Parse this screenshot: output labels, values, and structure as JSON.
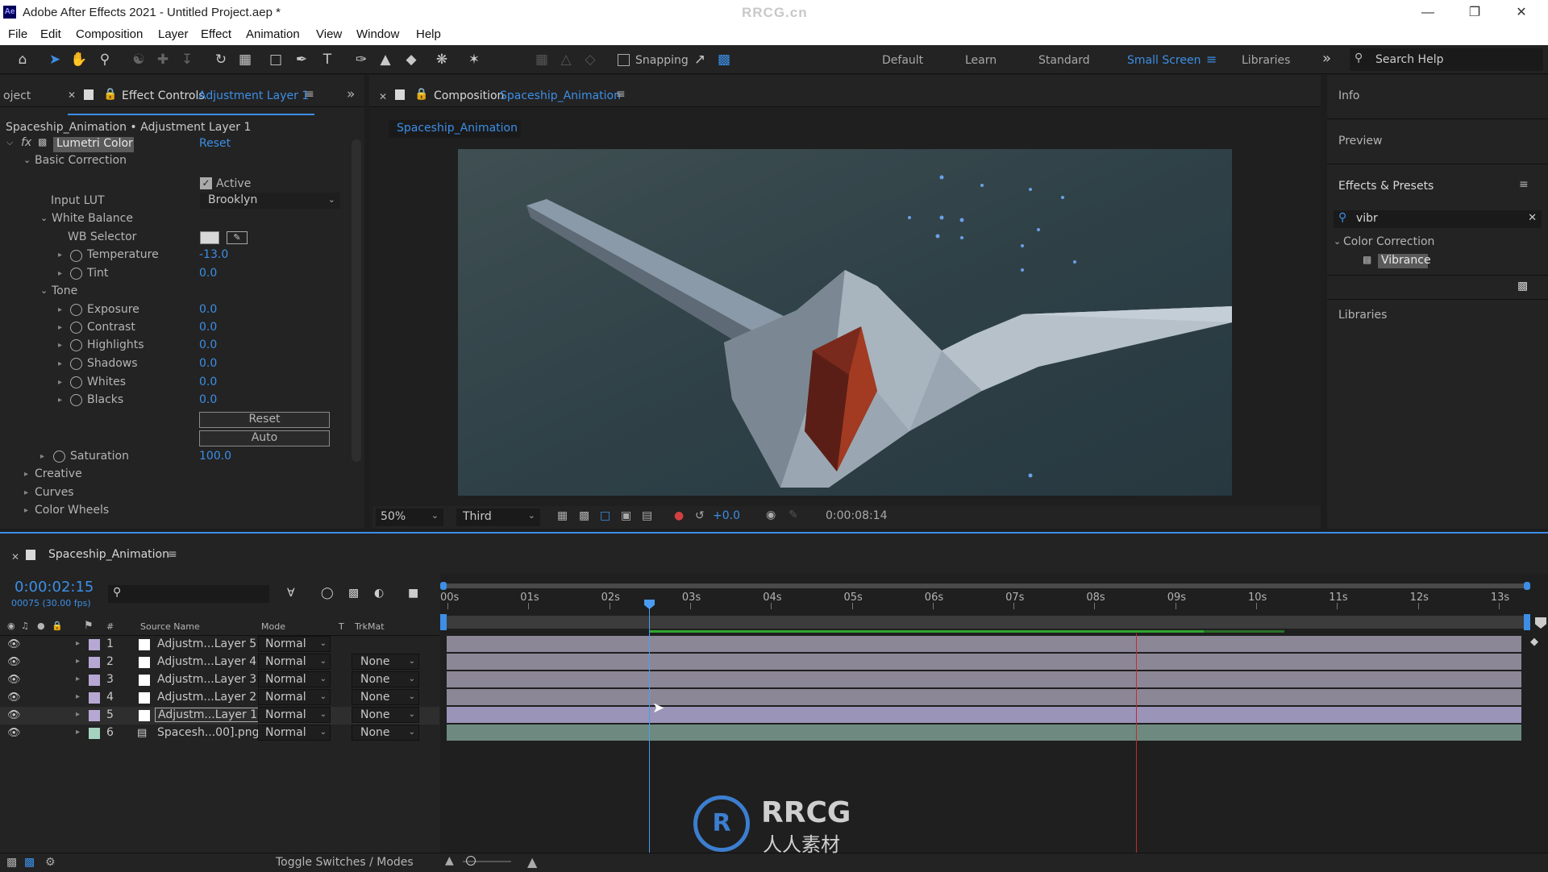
{
  "window": {
    "title": "Adobe After Effects 2021 - Untitled Project.aep *",
    "watermark": "RRCG.cn",
    "app_icon": "Ae"
  },
  "menu": [
    "File",
    "Edit",
    "Composition",
    "Layer",
    "Effect",
    "Animation",
    "View",
    "Window",
    "Help"
  ],
  "toolbar": {
    "snapping": "Snapping",
    "workspaces": [
      "Default",
      "Learn",
      "Standard",
      "Small Screen",
      "Libraries"
    ],
    "active_workspace": "Small Screen",
    "search_placeholder": "Search Help"
  },
  "effect_controls": {
    "project_tab": "oject",
    "tab_label": "Effect Controls",
    "tab_layer": "Adjustment Layer 1",
    "breadcrumb": "Spaceship_Animation • Adjustment Layer 1",
    "effect": "Lumetri Color",
    "reset": "Reset",
    "basic_correction": "Basic Correction",
    "active": "Active",
    "input_lut_label": "Input LUT",
    "input_lut": "Brooklyn",
    "white_balance": "White Balance",
    "wb_selector": "WB Selector",
    "temperature_label": "Temperature",
    "temperature": "-13.0",
    "tint_label": "Tint",
    "tint": "0.0",
    "tone": "Tone",
    "tone_props": [
      {
        "label": "Exposure",
        "value": "0.0"
      },
      {
        "label": "Contrast",
        "value": "0.0"
      },
      {
        "label": "Highlights",
        "value": "0.0"
      },
      {
        "label": "Shadows",
        "value": "0.0"
      },
      {
        "label": "Whites",
        "value": "0.0"
      },
      {
        "label": "Blacks",
        "value": "0.0"
      }
    ],
    "reset_btn": "Reset",
    "auto_btn": "Auto",
    "saturation_label": "Saturation",
    "saturation": "100.0",
    "sections": [
      "Creative",
      "Curves",
      "Color Wheels"
    ]
  },
  "composition": {
    "tab_label": "Composition",
    "name": "Spaceship_Animation",
    "subtab": "Spaceship_Animation",
    "zoom": "50%",
    "resolution": "Third",
    "exposure": "+0.0",
    "timecode": "0:00:08:14"
  },
  "right_panel": {
    "info": "Info",
    "preview": "Preview",
    "effects_presets": "Effects & Presets",
    "search": "vibr",
    "category": "Color Correction",
    "item": "Vibrance",
    "libraries": "Libraries"
  },
  "timeline": {
    "name": "Spaceship_Animation",
    "timecode": "0:00:02:15",
    "frames": "00075 (30.00 fps)",
    "columns": {
      "source": "Source Name",
      "mode": "Mode",
      "t": "T",
      "trkmat": "TrkMat"
    },
    "ruler": [
      "00s",
      "01s",
      "02s",
      "03s",
      "04s",
      "05s",
      "06s",
      "07s",
      "08s",
      "09s",
      "10s",
      "11s",
      "12s",
      "13s"
    ],
    "layers": [
      {
        "num": "1",
        "name": "Adjustm...Layer 5",
        "mode": "Normal",
        "trkmat": "",
        "color": "#b7a8d3"
      },
      {
        "num": "2",
        "name": "Adjustm...Layer 4",
        "mode": "Normal",
        "trkmat": "None",
        "color": "#b7a8d3"
      },
      {
        "num": "3",
        "name": "Adjustm...Layer 3",
        "mode": "Normal",
        "trkmat": "None",
        "color": "#b7a8d3"
      },
      {
        "num": "4",
        "name": "Adjustm...Layer 2",
        "mode": "Normal",
        "trkmat": "None",
        "color": "#b7a8d3"
      },
      {
        "num": "5",
        "name": "Adjustm...Layer 1",
        "mode": "Normal",
        "trkmat": "None",
        "color": "#b7a8d3"
      },
      {
        "num": "6",
        "name": "Spacesh...00].png",
        "mode": "Normal",
        "trkmat": "None",
        "color": "#a6d3c0"
      }
    ],
    "toggle": "Toggle Switches / Modes"
  },
  "watermark": {
    "brand": "RRCG",
    "sub": "人人素材"
  },
  "colors": {
    "accent": "#3c8ee6",
    "playhead": "#4a9cf0",
    "work_end": "#c8282f"
  }
}
